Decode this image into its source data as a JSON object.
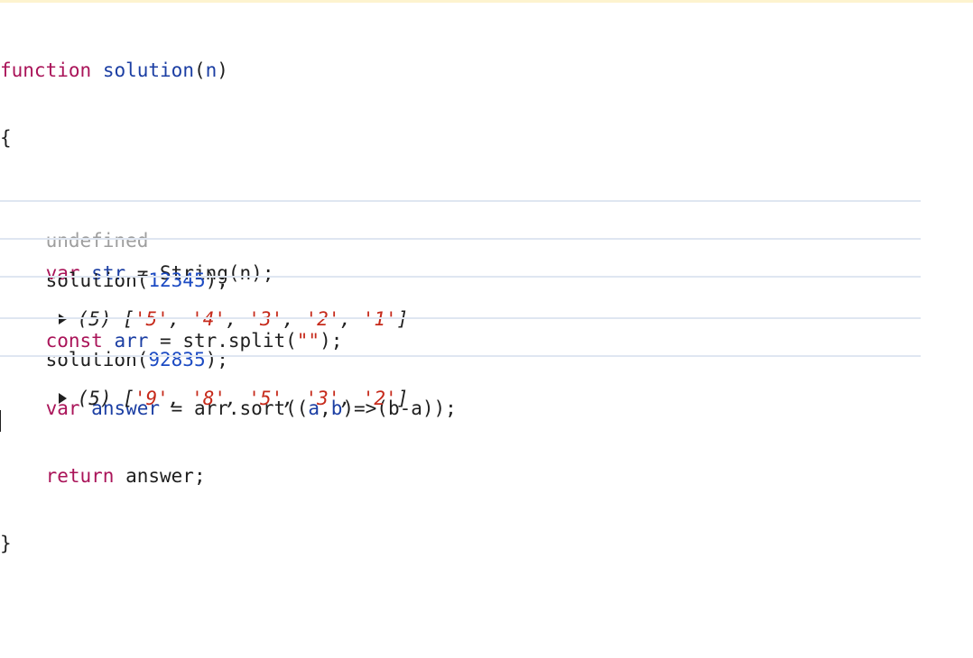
{
  "code_block": {
    "line1": {
      "kw": "function",
      "name": "solution",
      "paren_open": "(",
      "param": "n",
      "paren_close": ")"
    },
    "line2": "{",
    "line3": {
      "kw": "var",
      "id": "str",
      "rest": " = String(n);"
    },
    "line4": {
      "kw": "const",
      "id": "arr",
      "rest_a": " = str.split(",
      "str": "\"\"",
      "rest_b": ");"
    },
    "line5": {
      "kw": "var",
      "id": "answer",
      "rest_a": " = arr.sort((",
      "a": "a",
      "comma": ",",
      "b": "b",
      "rest_b": ")=>(b-a));"
    },
    "line6": {
      "kw": "return",
      "rest": " answer;"
    },
    "line7": "}"
  },
  "output_undefined": "undefined",
  "call1": {
    "fn": "solution(",
    "arg": "12345",
    "end": ");"
  },
  "result1": {
    "count": "(5)",
    "open": "[",
    "items": [
      "'5'",
      "'4'",
      "'3'",
      "'2'",
      "'1'"
    ],
    "close": "]"
  },
  "call2": {
    "fn": "solution(",
    "arg": "92835",
    "end": ");"
  },
  "result2": {
    "count": "(5)",
    "open": "[",
    "items": [
      "'9'",
      "'8'",
      "'5'",
      "'3'",
      "'2'"
    ],
    "close": "]"
  },
  "colors": {
    "keyword": "#aa1459",
    "identifier": "#1b3ea3",
    "number": "#1c4bc3",
    "string": "#c62a1b",
    "muted": "#9e9e9e",
    "separator": "#dfe6f1"
  }
}
